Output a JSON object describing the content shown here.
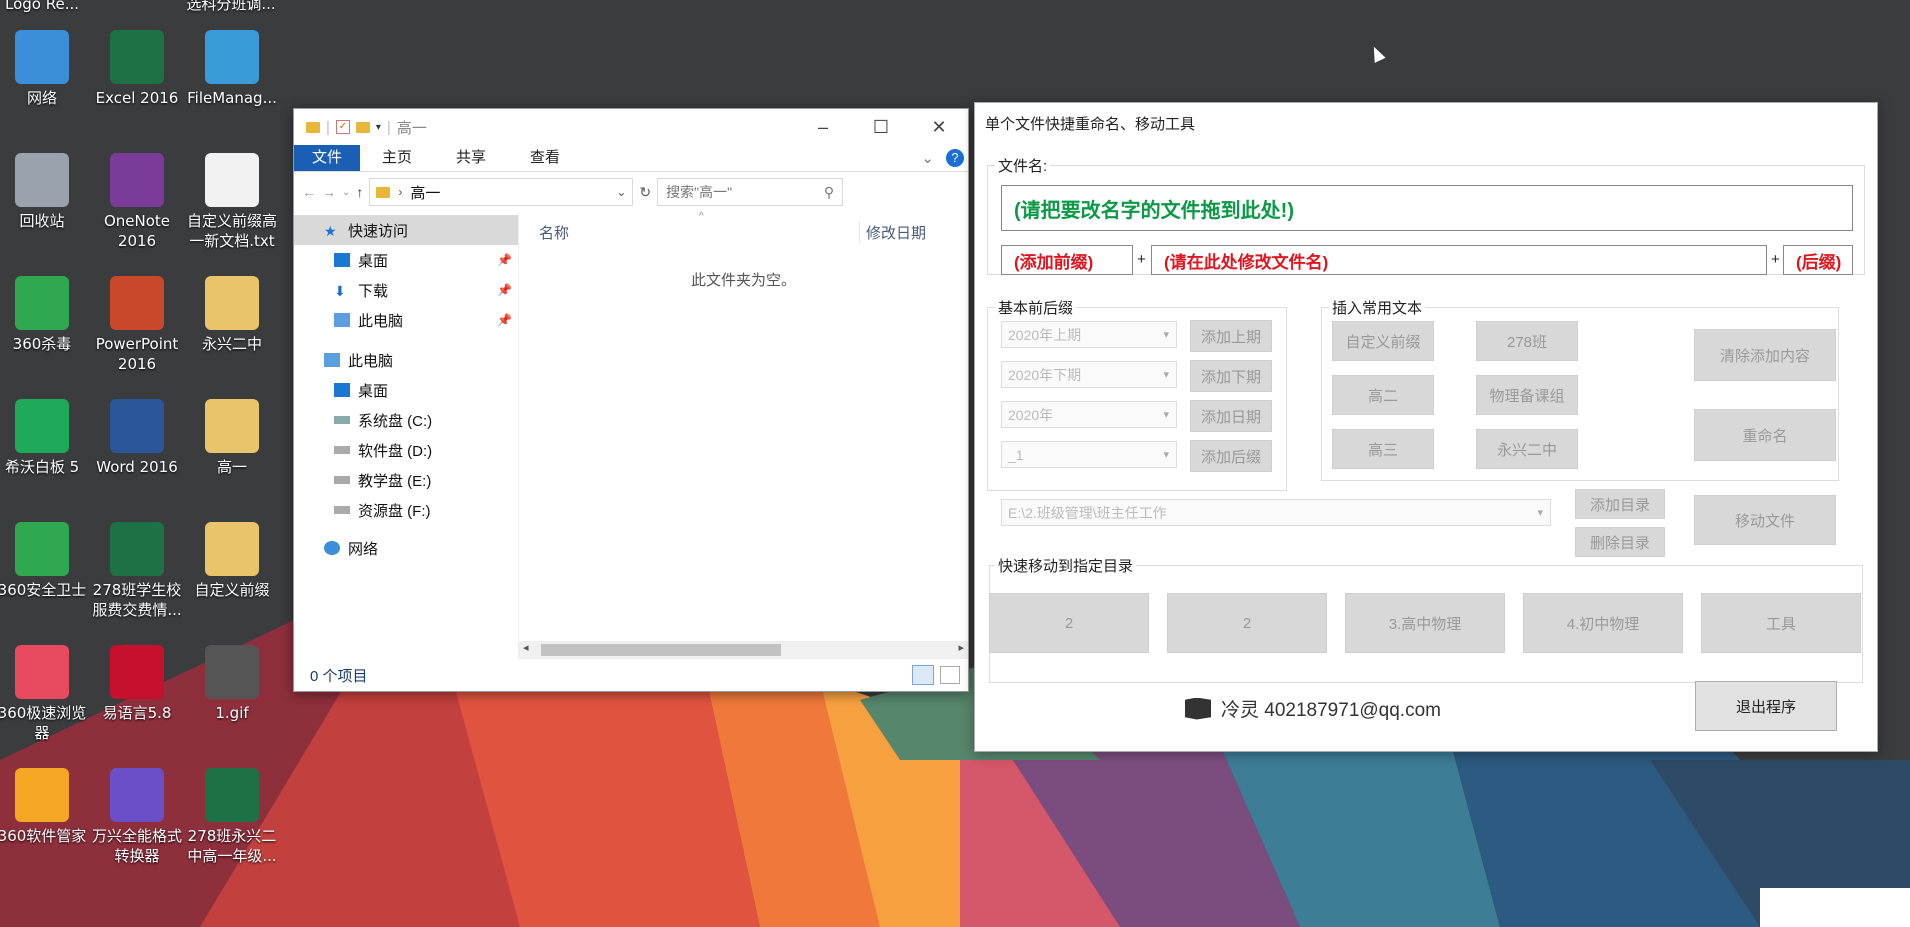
{
  "desktop": {
    "top_partial_labels": [
      "Logo Re...",
      "选科分班调..."
    ],
    "icons": [
      {
        "id": "network",
        "label": "网络",
        "icon": "globe-network-icon",
        "color": "#3a8fd8"
      },
      {
        "id": "excel",
        "label": "Excel 2016",
        "icon": "excel-icon",
        "color": "#1e7145"
      },
      {
        "id": "filemanager",
        "label": "FileManag...",
        "icon": "cube-icon",
        "color": "#3a9bd8"
      },
      {
        "id": "recycle",
        "label": "回收站",
        "icon": "recycle-bin-icon",
        "color": "#9aa3ad"
      },
      {
        "id": "onenote",
        "label": "OneNote\n2016",
        "icon": "onenote-icon",
        "color": "#7b3b98"
      },
      {
        "id": "txtfile",
        "label": "自定义前缀高\n一新文档.txt",
        "icon": "text-file-icon",
        "color": "#f2f2f2"
      },
      {
        "id": "av360",
        "label": "360杀毒",
        "icon": "shield-icon",
        "color": "#2fa84f"
      },
      {
        "id": "powerpoint",
        "label": "PowerPoint\n2016",
        "icon": "powerpoint-icon",
        "color": "#c9472b"
      },
      {
        "id": "folder_yx",
        "label": "永兴二中",
        "icon": "folder-icon",
        "color": "#e9c46a"
      },
      {
        "id": "easinote",
        "label": "希沃白板 5",
        "icon": "en-board-icon",
        "color": "#1eaa58"
      },
      {
        "id": "word",
        "label": "Word 2016",
        "icon": "word-icon",
        "color": "#2b579a"
      },
      {
        "id": "folder_g1",
        "label": "高一",
        "icon": "folder-icon",
        "color": "#e9c46a"
      },
      {
        "id": "guard360",
        "label": "360安全卫士",
        "icon": "plus-shield-icon",
        "color": "#2fa84f"
      },
      {
        "id": "xls278",
        "label": "278班学生校\n服费交费情...",
        "icon": "excel-file-icon",
        "color": "#1e7145"
      },
      {
        "id": "folder_prefix",
        "label": "自定义前缀",
        "icon": "folder-icon",
        "color": "#e9c46a"
      },
      {
        "id": "browser360",
        "label": "360极速浏览\n器",
        "icon": "browser-icon",
        "color": "#e84a5f"
      },
      {
        "id": "eyuyan",
        "label": "易语言5.8",
        "icon": "eyuyan-icon",
        "color": "#c8102e"
      },
      {
        "id": "gif",
        "label": "1.gif",
        "icon": "image-file-icon",
        "color": "#555555"
      },
      {
        "id": "mgr360",
        "label": "360软件管家",
        "icon": "flower-icon",
        "color": "#f5a623"
      },
      {
        "id": "converter",
        "label": "万兴全能格式\n转换器",
        "icon": "play-icon",
        "color": "#6a4fc9"
      },
      {
        "id": "xls278b",
        "label": "278班永兴二\n中高一年级...",
        "icon": "excel-file-icon",
        "color": "#1e7145"
      }
    ]
  },
  "explorer": {
    "title": "高一",
    "ribbon_tabs": [
      "文件",
      "主页",
      "共享",
      "查看"
    ],
    "address": "高一",
    "search_placeholder": "搜索\"高一\"",
    "nav": {
      "quick_access": "快速访问",
      "desktop": "桌面",
      "downloads": "下载",
      "this_pc_pinned": "此电脑",
      "this_pc": "此电脑",
      "desktop2": "桌面",
      "drive_c": "系统盘 (C:)",
      "drive_d": "软件盘 (D:)",
      "drive_e": "教学盘 (E:)",
      "drive_f": "资源盘 (F:)",
      "network": "网络"
    },
    "columns": {
      "name": "名称",
      "modified": "修改日期"
    },
    "empty_text": "此文件夹为空。",
    "status": "0 个项目"
  },
  "tool": {
    "title": "单个文件快捷重命名、移动工具",
    "filename_group": "文件名:",
    "drop_hint": "(请把要改名字的文件拖到此处!)",
    "prefix": "(添加前缀)",
    "main_name": "(请在此处修改文件名)",
    "suffix": "(后缀)",
    "plus": "+",
    "basic_group": "基本前后缀",
    "combos": [
      "2020年上期",
      "2020年下期",
      "2020年",
      "_1"
    ],
    "basic_buttons": [
      "添加上期",
      "添加下期",
      "添加日期",
      "添加后缀"
    ],
    "insert_group": "插入常用文本",
    "insert_buttons": [
      "自定义前缀",
      "278班",
      "高二",
      "物理备课组",
      "高三",
      "永兴二中"
    ],
    "clear_button": "清除添加内容",
    "rename_button": "重命名",
    "dir_combo": "E:\\2.班级管理\\班主任工作",
    "add_dir": "添加目录",
    "del_dir": "删除目录",
    "move_file": "移动文件",
    "quick_move_group": "快速移动到指定目录",
    "quick_dirs": [
      "2",
      "2",
      "3.高中物理",
      "4.初中物理",
      "工具"
    ],
    "footer": "冷灵 402187971@qq.com",
    "exit_button": "退出程序"
  }
}
